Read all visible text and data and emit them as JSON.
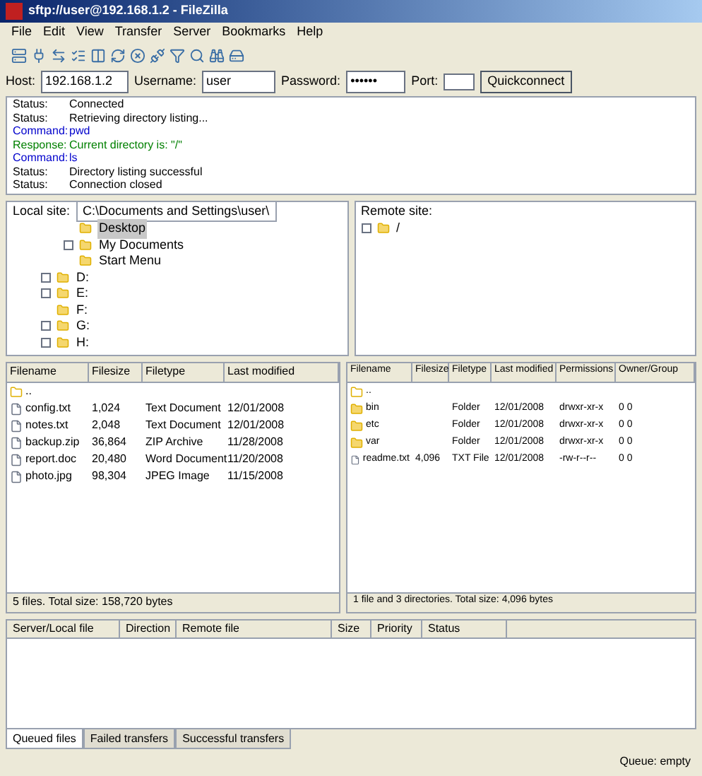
{
  "window": {
    "title": "sftp://user@192.168.1.2 - FileZilla"
  },
  "menu": [
    "File",
    "Edit",
    "View",
    "Transfer",
    "Server",
    "Bookmarks",
    "Help"
  ],
  "quickconnect": {
    "host_label": "Host:",
    "host": "192.168.1.2",
    "user_label": "Username:",
    "user": "user",
    "password_label": "Password:",
    "password": "••••••",
    "port_label": "Port:",
    "button": "Quickconnect"
  },
  "log": [
    {
      "kind": "status",
      "label": "Status:",
      "text": "Connected"
    },
    {
      "kind": "status",
      "label": "Status:",
      "text": "Retrieving directory listing..."
    },
    {
      "kind": "command",
      "label": "Command:",
      "text": "pwd"
    },
    {
      "kind": "response",
      "label": "Response:",
      "text": "Current directory is: \"/\""
    },
    {
      "kind": "command",
      "label": "Command:",
      "text": "ls"
    },
    {
      "kind": "status",
      "label": "Status:",
      "text": "Directory listing successful"
    },
    {
      "kind": "status",
      "label": "Status:",
      "text": "Connection closed"
    }
  ],
  "local_tree": {
    "label": "Local site:",
    "path": "C:\\Documents and Settings\\user\\",
    "items": [
      {
        "name": "Desktop",
        "selected": true,
        "expandable": false
      },
      {
        "name": "My Documents",
        "selected": false,
        "expandable": true
      },
      {
        "name": "Start Menu",
        "selected": false,
        "expandable": false
      },
      {
        "name": "D:",
        "selected": false,
        "expandable": true
      },
      {
        "name": "E:",
        "selected": false,
        "expandable": true
      },
      {
        "name": "F:",
        "selected": false,
        "expandable": false
      },
      {
        "name": "G:",
        "selected": false,
        "expandable": true
      },
      {
        "name": "H:",
        "selected": false,
        "expandable": true
      }
    ]
  },
  "remote_tree": {
    "label": "Remote site:",
    "items": [
      {
        "name": "/",
        "selected": false,
        "expandable": true
      }
    ]
  },
  "local_list": {
    "columns": [
      "Filename",
      "Filesize",
      "Filetype",
      "Last modified"
    ],
    "rows": [
      {
        "kind": "parent",
        "name": ".."
      },
      {
        "kind": "file",
        "name": "config.txt",
        "size": "1,024",
        "type": "Text Document",
        "modified": "12/01/2008"
      },
      {
        "kind": "file",
        "name": "notes.txt",
        "size": "2,048",
        "type": "Text Document",
        "modified": "12/01/2008"
      },
      {
        "kind": "file",
        "name": "backup.zip",
        "size": "36,864",
        "type": "ZIP Archive",
        "modified": "11/28/2008"
      },
      {
        "kind": "file",
        "name": "report.doc",
        "size": "20,480",
        "type": "Word Document",
        "modified": "11/20/2008"
      },
      {
        "kind": "file",
        "name": "photo.jpg",
        "size": "98,304",
        "type": "JPEG Image",
        "modified": "11/15/2008"
      }
    ],
    "footer": "5 files. Total size: 158,720 bytes"
  },
  "remote_list": {
    "columns": [
      "Filename",
      "Filesize",
      "Filetype",
      "Last modified",
      "Permissions",
      "Owner/Group"
    ],
    "rows": [
      {
        "kind": "parent",
        "name": ".."
      },
      {
        "kind": "folder",
        "name": "bin",
        "size": "",
        "type": "Folder",
        "modified": "12/01/2008",
        "permissions": "drwxr-xr-x",
        "owner": "0 0"
      },
      {
        "kind": "folder",
        "name": "etc",
        "size": "",
        "type": "Folder",
        "modified": "12/01/2008",
        "permissions": "drwxr-xr-x",
        "owner": "0 0"
      },
      {
        "kind": "folder",
        "name": "var",
        "size": "",
        "type": "Folder",
        "modified": "12/01/2008",
        "permissions": "drwxr-xr-x",
        "owner": "0 0"
      },
      {
        "kind": "file",
        "name": "readme.txt",
        "size": "4,096",
        "type": "TXT File",
        "modified": "12/01/2008",
        "permissions": "-rw-r--r--",
        "owner": "0 0"
      }
    ],
    "footer": "1 file and 3 directories. Total size: 4,096 bytes"
  },
  "queue": {
    "columns": [
      "Server/Local file",
      "Direction",
      "Remote file",
      "Size",
      "Priority",
      "Status"
    ]
  },
  "queue_tabs": [
    {
      "label": "Queued files",
      "selected": true
    },
    {
      "label": "Failed transfers",
      "selected": false
    },
    {
      "label": "Successful transfers",
      "selected": false
    }
  ],
  "status_bar": {
    "queue": "Queue: empty"
  }
}
